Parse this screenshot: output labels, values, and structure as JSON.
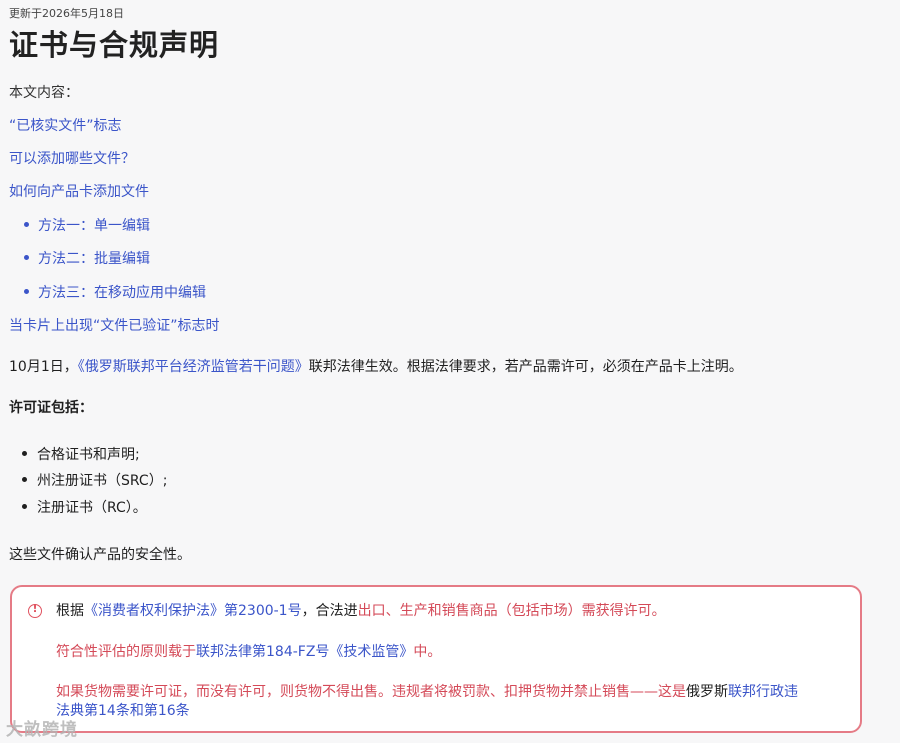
{
  "header": {
    "updated": "更新于2026年5月18日",
    "title": "证书与合规声明"
  },
  "toc": {
    "heading": "本文内容：",
    "items": [
      "“已核实文件”标志",
      "可以添加哪些文件？",
      "如何向产品卡添加文件"
    ],
    "sub_items": [
      "方法一：单一编辑",
      "方法二：批量编辑",
      "方法三：在移动应用中编辑"
    ],
    "last_item": "当卡片上出现“文件已验证”标志时"
  },
  "intro": {
    "prefix": "10月1日，",
    "law_link": "《俄罗斯联邦平台经济监管若干问题》",
    "suffix": "联邦法律生效。根据法律要求，若产品需许可，必须在产品卡上注明。"
  },
  "licenses": {
    "heading": "许可证包括：",
    "items": [
      "合格证书和声明;",
      "州注册证书（SRC）;",
      "注册证书（RC）。"
    ]
  },
  "safety_note": "这些文件确认产品的安全性。",
  "notice": {
    "line1_a": "根据",
    "line1_link": "《消费者权利保护法》第2300-1号",
    "line1_b": "，合法进",
    "line1_c": "出口、生产和销售商品（包括市场）需获得许可。",
    "line2_a": "符合性评估的原则载于",
    "line2_link": "联邦法律第184-FZ号《技术监管》",
    "line2_b": "中。",
    "line3_a": "如果货物需要许可证，而没有许可，则货物不得出售。违规者将被罚款、扣押货物并禁止销售——这是",
    "line3_b": "俄罗斯",
    "line3_link1": "联邦行政违",
    "line3_link2": "法典第14条和第16条",
    "accent_color": "#e57b86"
  },
  "watermark": "大畝跨境"
}
